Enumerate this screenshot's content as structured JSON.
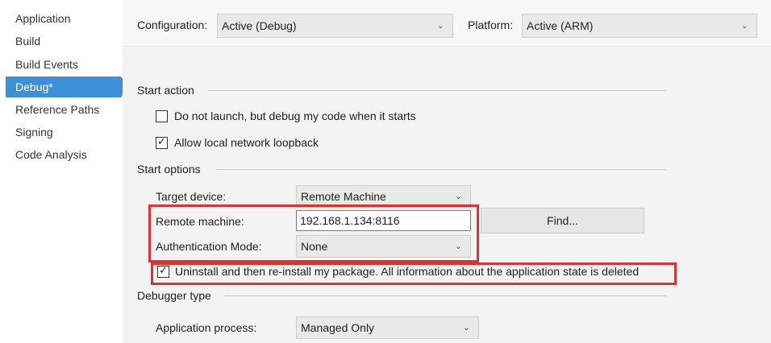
{
  "sidebar": {
    "items": [
      {
        "label": "Application"
      },
      {
        "label": "Build"
      },
      {
        "label": "Build Events"
      },
      {
        "label": "Debug*",
        "selected": true
      },
      {
        "label": "Reference Paths"
      },
      {
        "label": "Signing"
      },
      {
        "label": "Code Analysis"
      }
    ]
  },
  "config_bar": {
    "configuration_label": "Configuration:",
    "configuration_value": "Active (Debug)",
    "platform_label": "Platform:",
    "platform_value": "Active (ARM)"
  },
  "start_action": {
    "title": "Start action",
    "do_not_launch_label": "Do not launch, but debug my code when it starts",
    "do_not_launch_checked": false,
    "loopback_label": "Allow local network loopback",
    "loopback_checked": true
  },
  "start_options": {
    "title": "Start options",
    "target_device_label": "Target device:",
    "target_device_value": "Remote Machine",
    "remote_machine_label": "Remote machine:",
    "remote_machine_value": "192.168.1.134:8116",
    "find_button": "Find...",
    "auth_mode_label": "Authentication Mode:",
    "auth_mode_value": "None",
    "reinstall_label": "Uninstall and then re-install my package. All information about the application state is deleted",
    "reinstall_checked": true
  },
  "debugger_type": {
    "title": "Debugger type",
    "app_process_label": "Application process:",
    "app_process_value": "Managed Only"
  },
  "colors": {
    "selected_bg": "#3d8fd8",
    "highlight": "#e0312f"
  },
  "icons": {
    "dropdown": "chevron-down-icon",
    "check": "checkmark-icon"
  }
}
